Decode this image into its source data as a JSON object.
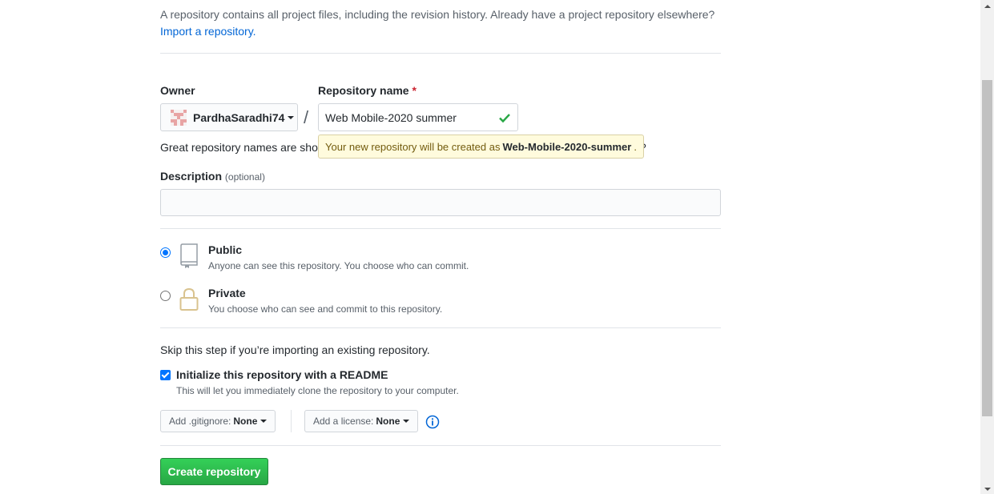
{
  "intro": {
    "text": "A repository contains all project files, including the revision history. Already have a project repository elsewhere?",
    "import_link": "Import a repository."
  },
  "owner": {
    "label": "Owner",
    "value": "PardhaSaradhi74"
  },
  "repo_name": {
    "label": "Repository name",
    "required_mark": "*",
    "value": "Web Mobile-2020 summer",
    "hint_start": "Great repository names are shor",
    "hint_end": "?"
  },
  "tooltip": {
    "prefix": "Your new repository will be created as",
    "name": "Web-Mobile-2020-summer",
    "suffix": "."
  },
  "description": {
    "label": "Description",
    "optional": "(optional)",
    "value": ""
  },
  "visibility": {
    "public": {
      "title": "Public",
      "note": "Anyone can see this repository. You choose who can commit.",
      "selected": true
    },
    "private": {
      "title": "Private",
      "note": "You choose who can see and commit to this repository.",
      "selected": false
    }
  },
  "init": {
    "skip_text": "Skip this step if you’re importing an existing repository.",
    "readme_label": "Initialize this repository with a README",
    "readme_note": "This will let you immediately clone the repository to your computer.",
    "readme_checked": true
  },
  "gitignore": {
    "label": "Add .gitignore:",
    "value": "None"
  },
  "license": {
    "label": "Add a license:",
    "value": "None"
  },
  "create_button": "Create repository",
  "colors": {
    "primary": "#28a745",
    "link": "#0366d6",
    "required": "#cb2431",
    "check": "#28a745"
  }
}
